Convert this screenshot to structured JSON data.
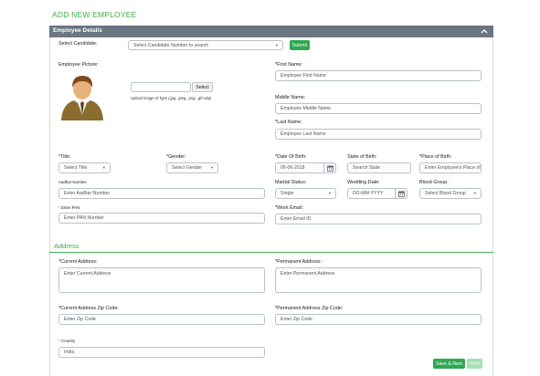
{
  "page_title": "ADD NEW EMPLOYEE",
  "panel": {
    "title": "Employee Details"
  },
  "candidate": {
    "label": "Select Candidate:",
    "placeholder": "Select Candidate Number to search",
    "submit_label": "Submit"
  },
  "picture": {
    "label": "Employee Picture:",
    "select_label": "Select",
    "hint": "Upload Image of Type (.jpg, .jpeg, .png, .gif only)"
  },
  "first_name": {
    "label": "First Name:",
    "placeholder": "Employee First Name"
  },
  "middle_name": {
    "label": "Middle Name:",
    "placeholder": "Employee Middle Name"
  },
  "last_name": {
    "label": "Last Name:",
    "placeholder": "Employee Last Name"
  },
  "title": {
    "label": "Title:",
    "value": "Select Title"
  },
  "gender": {
    "label": "Gender:",
    "value": "Select Gender"
  },
  "dob": {
    "label": "Date Of Birth:",
    "value": "06-06-2018"
  },
  "state_of_birth": {
    "label": "State of Birth:",
    "placeholder": "Search State"
  },
  "place_of_birth": {
    "label": "Place of Birth:",
    "placeholder": "Enter Employee's Place of B"
  },
  "aadhar": {
    "label": "Aadhar Number",
    "placeholder": "Enter Aadhar Number"
  },
  "marital": {
    "label": "Marital Status:",
    "value": "Single"
  },
  "wedding": {
    "label": "Wedding Date:",
    "placeholder": "DD-MM-YYYY"
  },
  "blood_group": {
    "label": "Blood Group:",
    "value": "Select Blood Group"
  },
  "pan": {
    "label": "Enter PAN",
    "placeholder": "Enter PAN Number"
  },
  "work_email": {
    "label": "Work Email:",
    "placeholder": "Enter Email ID"
  },
  "address_section": {
    "title": "Address"
  },
  "current_address": {
    "label": "Current Address:",
    "placeholder": "Enter Current Address"
  },
  "permanent_address": {
    "label": "Permanent Address:",
    "placeholder": "Enter Permanent Address"
  },
  "current_zip": {
    "label": "Current Address Zip Code:",
    "placeholder": "Enter Zip Code"
  },
  "permanent_zip": {
    "label": "Permanent Address Zip Code:",
    "placeholder": "Enter Zip Code"
  },
  "country": {
    "label": "Country",
    "value": "India"
  },
  "actions": {
    "save_label": "Save & Next",
    "print_label": "Print"
  },
  "required_mark": "*",
  "colors": {
    "accent": "#3fae49",
    "header": "#6a7681",
    "button": "#2ea851"
  },
  "icons": {
    "collapse": "chevron-up-icon",
    "calendar": "calendar-icon",
    "avatar": "employee-avatar-icon"
  }
}
